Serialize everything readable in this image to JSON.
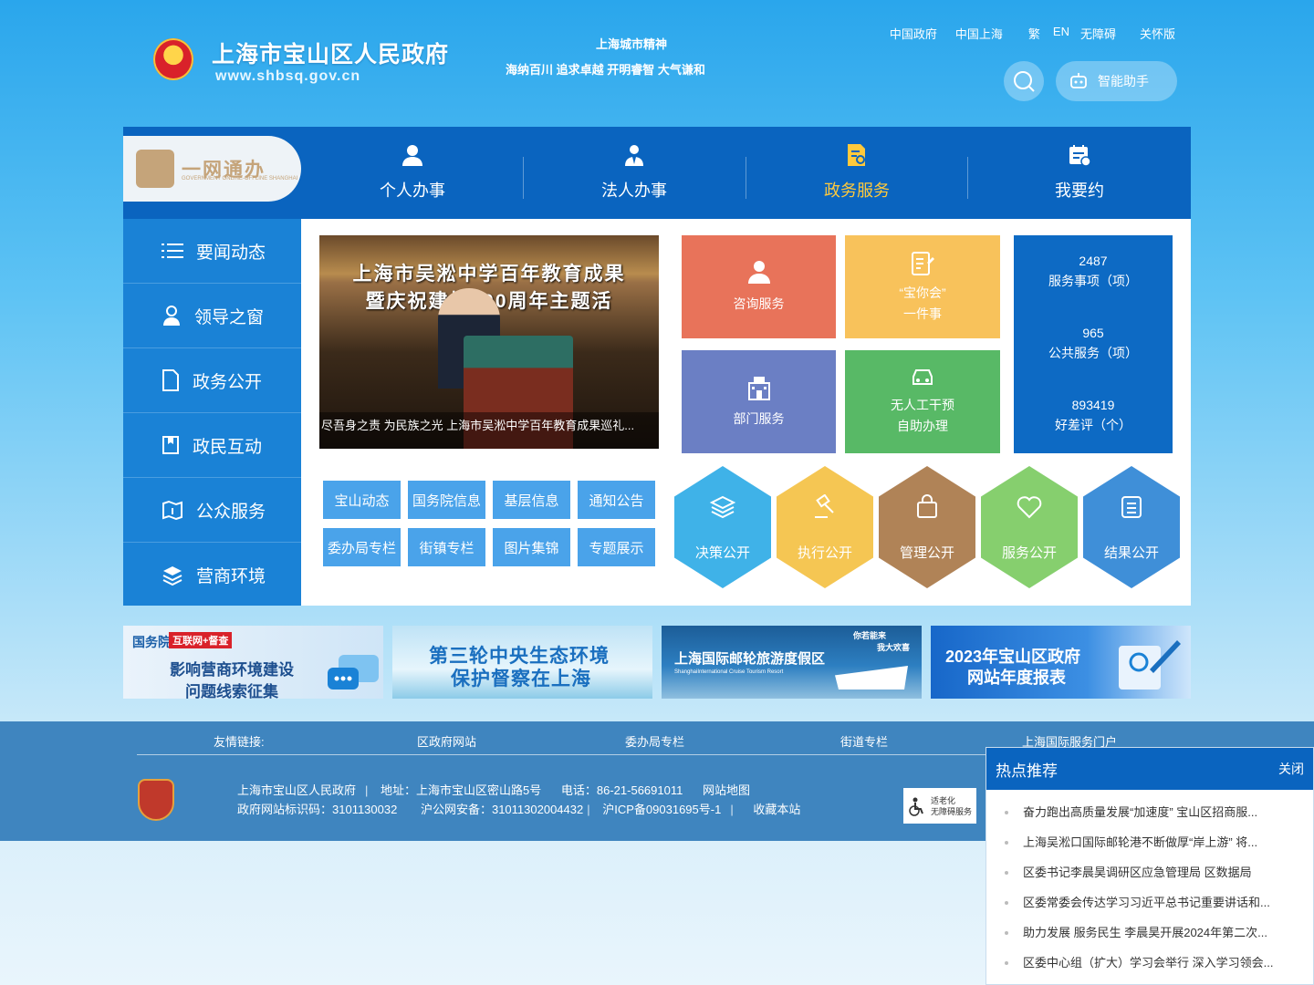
{
  "header": {
    "title": "上海市宝山区人民政府",
    "url": "www.shbsq.gov.cn",
    "spirit_title": "上海城市精神",
    "spirit_text": "海纳百川 追求卓越 开明睿智 大气谦和",
    "links": [
      "中国政府",
      "中国上海",
      "繁",
      "EN",
      "无障碍",
      "关怀版"
    ],
    "assistant_label": "智能助手"
  },
  "ywtb": {
    "name": "一网通办",
    "sub": "GOVERNMENT ONLINE-OFFLINE SHANGHAI"
  },
  "topnav": [
    {
      "label": "个人办事",
      "icon": "person-icon"
    },
    {
      "label": "法人办事",
      "icon": "group-icon"
    },
    {
      "label": "政务服务",
      "icon": "document-search-icon"
    },
    {
      "label": "我要约",
      "icon": "calendar-check-icon"
    }
  ],
  "sidenav": [
    {
      "label": "要闻动态",
      "icon": "list-icon"
    },
    {
      "label": "领导之窗",
      "icon": "user-icon"
    },
    {
      "label": "政务公开",
      "icon": "file-icon"
    },
    {
      "label": "政民互动",
      "icon": "bookmark-icon"
    },
    {
      "label": "公众服务",
      "icon": "map-icon"
    },
    {
      "label": "营商环境",
      "icon": "layers-icon"
    }
  ],
  "photo": {
    "line1": "上海市吴淞中学百年教育成果",
    "line2": "暨庆祝建校100周年主题活",
    "caption": "尽吾身之责 为民族之光 上海市吴淞中学百年教育成果巡礼..."
  },
  "tags": [
    "宝山动态",
    "国务院信息",
    "基层信息",
    "通知公告",
    "委办局专栏",
    "街镇专栏",
    "图片集锦",
    "专题展示"
  ],
  "tiles": [
    {
      "line1": "咨询服务",
      "line2": "",
      "color": "#e8735a",
      "icon": "person-icon"
    },
    {
      "line1": "“宝你会”",
      "line2": "一件事",
      "color": "#f8c25b",
      "icon": "edit-doc-icon"
    },
    {
      "line1": "部门服务",
      "line2": "",
      "color": "#6b7fc4",
      "icon": "building-icon"
    },
    {
      "line1": "无人工干预",
      "line2": "自助办理",
      "color": "#58b966",
      "icon": "car-icon"
    }
  ],
  "stats": [
    {
      "value": "2487",
      "label": "服务事项（项）"
    },
    {
      "value": "965",
      "label": "公共服务（项）"
    },
    {
      "value": "893419",
      "label": "好差评（个）"
    }
  ],
  "hexes": [
    {
      "label": "决策公开",
      "color": "#3fb2e8",
      "icon": "layers-icon"
    },
    {
      "label": "执行公开",
      "color": "#f5c653",
      "icon": "gavel-icon"
    },
    {
      "label": "管理公开",
      "color": "#b08357",
      "icon": "bag-icon"
    },
    {
      "label": "服务公开",
      "color": "#86cf6e",
      "icon": "heart-icon"
    },
    {
      "label": "结果公开",
      "color": "#3f8fd8",
      "icon": "clipboard-icon"
    }
  ],
  "banners": [
    {
      "tag1": "国务院",
      "tag2": "互联网+督查",
      "line1": "影响营商环境建设",
      "line2": "问题线索征集"
    },
    {
      "line1": "第三轮中央生态环境",
      "line2": "保护督察在上海"
    },
    {
      "line1": "上海国际邮轮旅游度假区",
      "line2": "ShanghaiInternational Cruise Tourism Resort",
      "corner1": "你若能来",
      "corner2": "我大欢喜"
    },
    {
      "line1": "2023年宝山区政府",
      "line2": "网站年度报表"
    }
  ],
  "footer": {
    "links_label": "友情链接:",
    "links": [
      "区政府网站",
      "委办局专栏",
      "街道专栏",
      "上海国际服务门户"
    ],
    "org": "上海市宝山区人民政府",
    "address": "地址：上海市宝山区密山路5号",
    "phone": "电话：86-21-56691011",
    "sitemap": "网站地图",
    "site_id": "政府网站标识码：3101130032",
    "police": "沪公网安备：31011302004432",
    "icp": "沪ICP备09031695号-1",
    "favorite": "收藏本站",
    "age_line1": "适老化",
    "age_line2": "无障碍服务"
  },
  "hot": {
    "title": "热点推荐",
    "close": "关闭",
    "items": [
      "奋力跑出高质量发展“加速度” 宝山区招商服...",
      "上海吴淞口国际邮轮港不断做厚“岸上游” 将...",
      "区委书记李晨昊调研区应急管理局 区数据局",
      "区委常委会传达学习习近平总书记重要讲话和...",
      "助力发展 服务民生 李晨昊开展2024年第二次...",
      "区委中心组（扩大）学习会举行 深入学习领会..."
    ]
  }
}
